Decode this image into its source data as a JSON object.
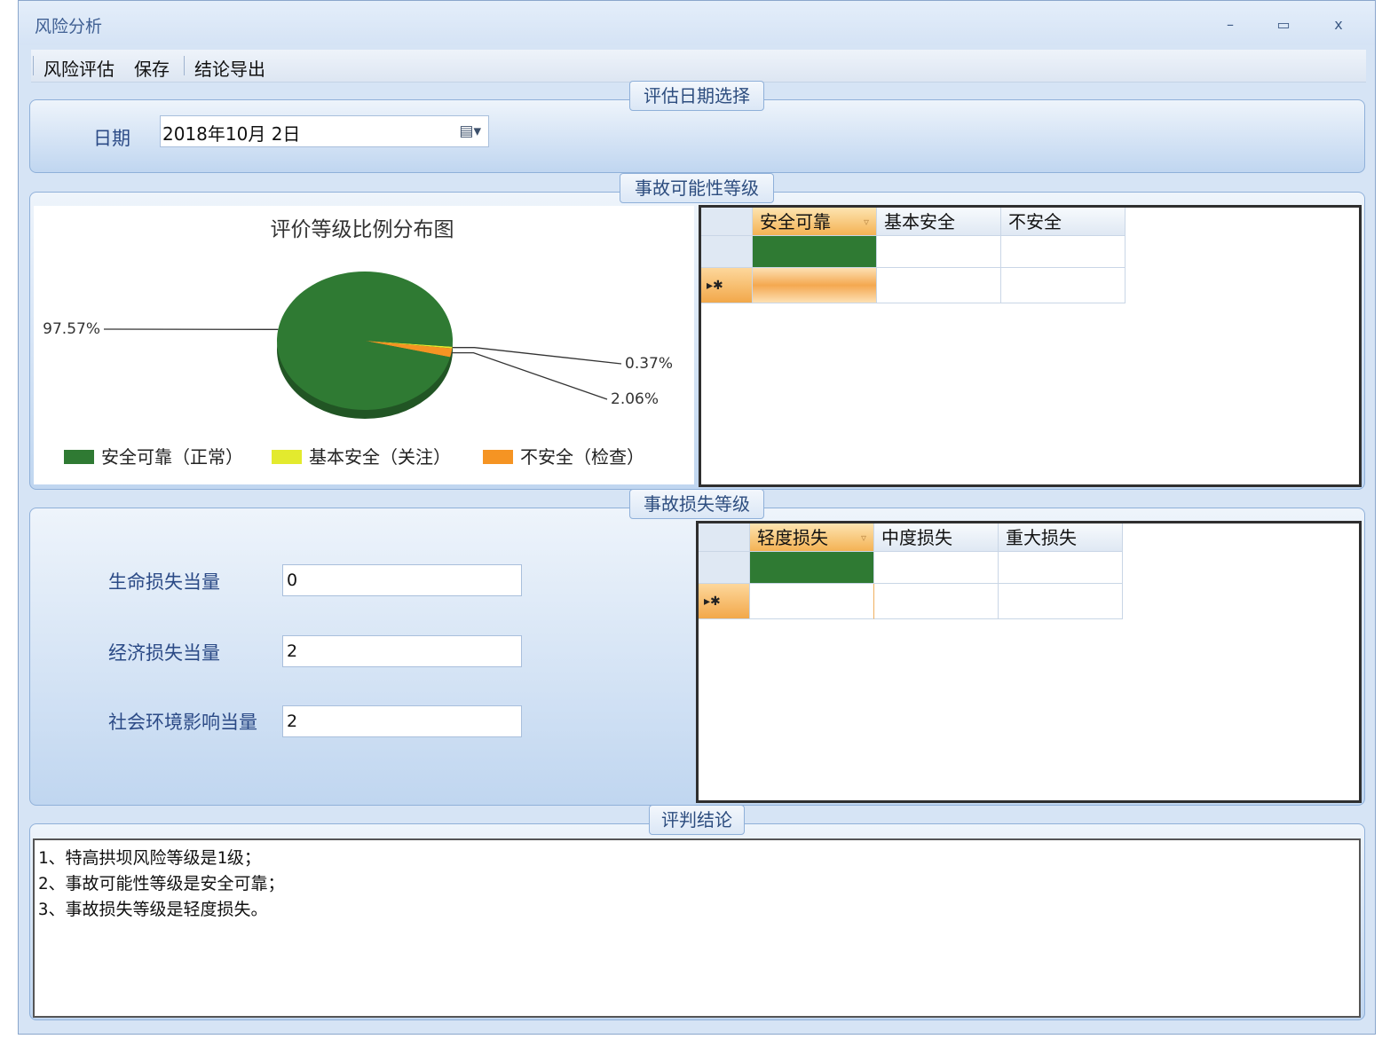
{
  "window": {
    "title": "风险分析",
    "minimize": "–",
    "maximize": "▭",
    "close": "x"
  },
  "menu": {
    "items": [
      "风险评估",
      "保存",
      "结论导出"
    ]
  },
  "date_section": {
    "legend": "评估日期选择",
    "label": "日期",
    "value": "2018年10月  2日",
    "calendar_icon": "calendar-dropdown-icon"
  },
  "probability_section": {
    "legend": "事故可能性等级",
    "chart_title": "评价等级比例分布图",
    "grid": {
      "columns": [
        "安全可靠",
        "基本安全",
        "不安全"
      ],
      "new_row_marker": "▸✱"
    }
  },
  "loss_section": {
    "legend": "事故损失等级",
    "fields": [
      {
        "label": "生命损失当量",
        "value": "0"
      },
      {
        "label": "经济损失当量",
        "value": "2"
      },
      {
        "label": "社会环境影响当量",
        "value": "2"
      }
    ],
    "grid": {
      "columns": [
        "轻度损失",
        "中度损失",
        "重大损失"
      ],
      "new_row_marker": "▸✱"
    }
  },
  "conclusion_section": {
    "legend": "评判结论",
    "lines": [
      "1、特高拱坝风险等级是1级；",
      "2、事故可能性等级是安全可靠；",
      "3、事故损失等级是轻度损失。"
    ]
  },
  "colors": {
    "green": "#2f7a33",
    "yellow": "#e3ea2e",
    "orange": "#f59423",
    "accent_blue": "#2b4a86"
  },
  "chart_data": {
    "type": "pie",
    "title": "评价等级比例分布图",
    "series": [
      {
        "name": "安全可靠（正常）",
        "value": 97.57,
        "label": "97.57%",
        "color": "#2f7a33"
      },
      {
        "name": "基本安全（关注）",
        "value": 0.37,
        "label": "0.37%",
        "color": "#e3ea2e"
      },
      {
        "name": "不安全（检查）",
        "value": 2.06,
        "label": "2.06%",
        "color": "#f59423"
      }
    ],
    "legend_position": "bottom"
  }
}
